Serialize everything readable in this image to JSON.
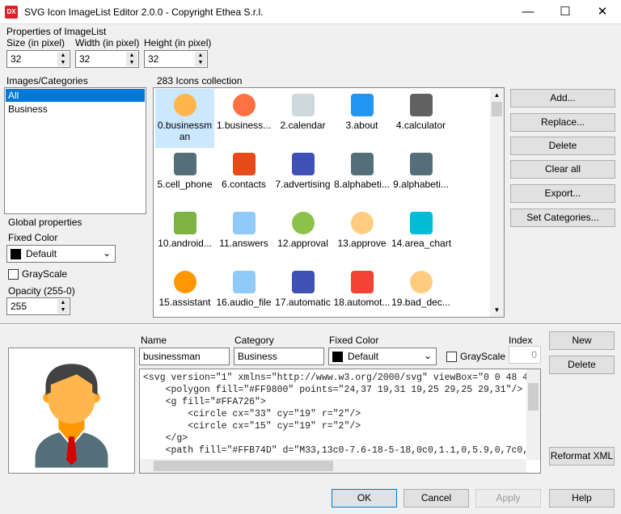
{
  "window": {
    "title": "SVG Icon ImageList Editor 2.0.0 - Copyright Ethea S.r.l.",
    "app_icon": "DX",
    "minimize": "—",
    "maximize": "☐",
    "close": "✕"
  },
  "properties": {
    "group": "Properties of ImageList",
    "size_label": "Size (in pixel)",
    "size": "32",
    "width_label": "Width (in pixel)",
    "width": "32",
    "height_label": "Height (in pixel)",
    "height": "32"
  },
  "categories": {
    "group": "Images/Categories",
    "items": [
      "All",
      "Business"
    ]
  },
  "global": {
    "group": "Global properties",
    "fixed_color_label": "Fixed Color",
    "fixed_color": "Default",
    "grayscale": "GrayScale",
    "opacity_label": "Opacity (255-0)",
    "opacity": "255"
  },
  "collection": {
    "group": "283 Icons collection",
    "icons": [
      {
        "label": "0.businessman",
        "color": "#FFB74D"
      },
      {
        "label": "1.business...",
        "color": "#FF7043"
      },
      {
        "label": "2.calendar",
        "color": "#CFD8DC"
      },
      {
        "label": "3.about",
        "color": "#2196F3"
      },
      {
        "label": "4.calculator",
        "color": "#616161"
      },
      {
        "label": "5.cell_phone",
        "color": "#546E7A"
      },
      {
        "label": "6.contacts",
        "color": "#E64A19"
      },
      {
        "label": "7.advertising",
        "color": "#3F51B5"
      },
      {
        "label": "8.alphabeti...",
        "color": "#546E7A"
      },
      {
        "label": "9.alphabeti...",
        "color": "#546E7A"
      },
      {
        "label": "10.android...",
        "color": "#7CB342"
      },
      {
        "label": "11.answers",
        "color": "#90CAF9"
      },
      {
        "label": "12.approval",
        "color": "#8BC34A"
      },
      {
        "label": "13.approve",
        "color": "#FFCC80"
      },
      {
        "label": "14.area_chart",
        "color": "#00BCD4"
      },
      {
        "label": "15.assistant",
        "color": "#FF9800"
      },
      {
        "label": "16.audio_file",
        "color": "#90CAF9"
      },
      {
        "label": "17.automatic",
        "color": "#3F51B5"
      },
      {
        "label": "18.automot...",
        "color": "#F44336"
      },
      {
        "label": "19.bad_dec...",
        "color": "#FFCC80"
      }
    ]
  },
  "actions": {
    "add": "Add...",
    "replace": "Replace...",
    "delete": "Delete",
    "clear_all": "Clear all",
    "export": "Export...",
    "set_categories": "Set Categories..."
  },
  "editor": {
    "name_label": "Name",
    "name": "businessman",
    "category_label": "Category",
    "category": "Business",
    "fixed_color_label": "Fixed Color",
    "fixed_color": "Default",
    "grayscale": "GrayScale",
    "index_label": "Index",
    "index": "0",
    "new": "New",
    "delete": "Delete",
    "reformat": "Reformat XML",
    "code": [
      "<svg version=\"1\" xmlns=\"http://www.w3.org/2000/svg\" viewBox=\"0 0 48 4",
      "    <polygon fill=\"#FF9800\" points=\"24,37 19,31 19,25 29,25 29,31\"/>",
      "    <g fill=\"#FFA726\">",
      "        <circle cx=\"33\" cy=\"19\" r=\"2\"/>",
      "        <circle cx=\"15\" cy=\"19\" r=\"2\"/>",
      "    </g>",
      "    <path fill=\"#FFB74D\" d=\"M33,13c0-7.6-18-5-18,0c0,1.1,0,5.9,0,7c0,"
    ]
  },
  "footer": {
    "ok": "OK",
    "cancel": "Cancel",
    "apply": "Apply",
    "help": "Help"
  }
}
